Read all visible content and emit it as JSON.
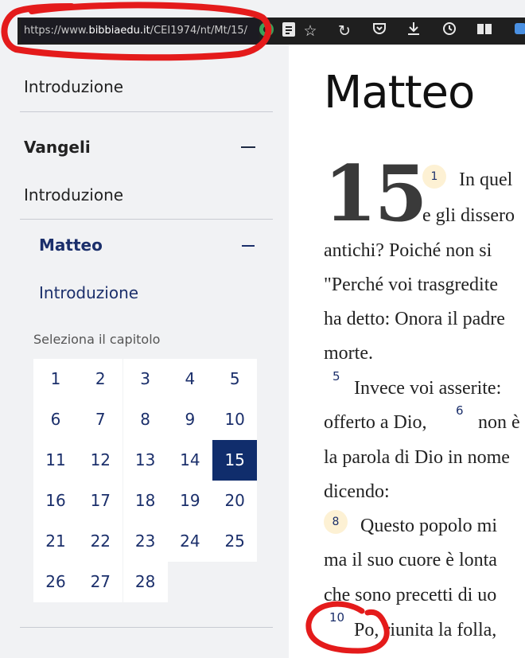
{
  "browser": {
    "url_prefix": "https://www.",
    "url_domain": "bibbiaedu.it",
    "url_path": "/CEI1974/nt/Mt/15/",
    "icons": [
      "extension-icon",
      "reader-icon",
      "star-icon",
      "reload-icon",
      "pocket-icon",
      "download-icon",
      "history-icon",
      "library-icon",
      "sync-icon"
    ]
  },
  "sidebar": {
    "intro_top": "Introduzione",
    "section": "Vangeli",
    "section_intro": "Introduzione",
    "book": "Matteo",
    "book_intro": "Introduzione",
    "chapter_label": "Seleziona il capitolo",
    "chapters": [
      "1",
      "2",
      "3",
      "4",
      "5",
      "6",
      "7",
      "8",
      "9",
      "10",
      "11",
      "12",
      "13",
      "14",
      "15",
      "16",
      "17",
      "18",
      "19",
      "20",
      "21",
      "22",
      "23",
      "24",
      "25",
      "26",
      "27",
      "28"
    ],
    "active_chapter": "15"
  },
  "content": {
    "title": "Matteo",
    "chapter": "15",
    "verse1_num": "1",
    "line1": "In quel",
    "line2": "e gli dissero",
    "line3": "antichi? Poiché non si",
    "line4": "\"Perché voi trasgredite",
    "line5": "ha detto: Onora il padre",
    "line6": "morte.",
    "verse5_num": "5",
    "line7": "Invece voi asserite:",
    "line8a": "offerto a Dio,",
    "verse6_num": "6",
    "line8b": "non è",
    "line9": "la parola di Dio in nome",
    "line10": "dicendo:",
    "verse8_num": "8",
    "line11": "Questo popolo mi",
    "line12": "ma il suo cuore è lonta",
    "line13": "che sono precetti di uo",
    "verse10_num": "10",
    "line14": "Po, riunita la folla,"
  }
}
